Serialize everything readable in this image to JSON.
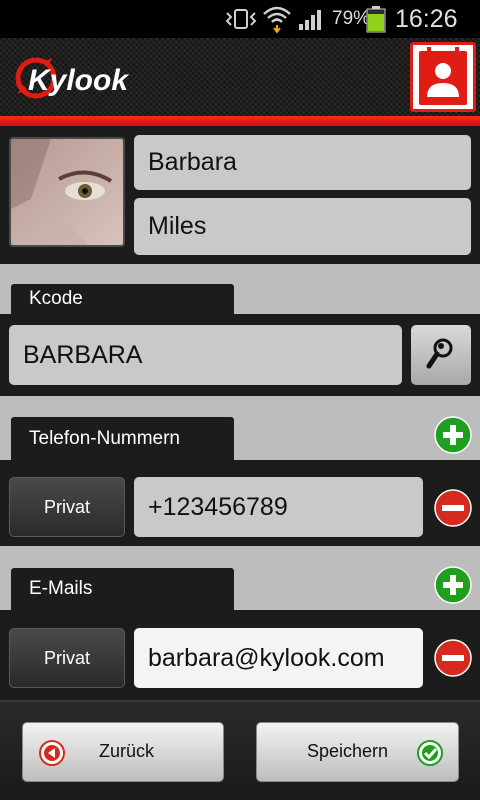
{
  "status_bar": {
    "battery_percent": "79%",
    "time": "16:26",
    "icons": [
      "vibrate-icon",
      "wifi-icon",
      "signal-icon",
      "battery-icon"
    ]
  },
  "header": {
    "logo_text": "Kylook",
    "contact_card_icon": "contact-card-icon",
    "accent_color": "#e01c14"
  },
  "contact": {
    "first_name": "Barbara",
    "last_name": "Miles"
  },
  "kcode": {
    "label": "Kcode",
    "value": "BARBARA",
    "search_icon": "magnifier-icon"
  },
  "phones": {
    "label": "Telefon-Nummern",
    "add_icon": "add-icon",
    "items": [
      {
        "type": "Privat",
        "value": "+123456789",
        "remove_icon": "remove-icon"
      }
    ]
  },
  "emails": {
    "label": "E-Mails",
    "add_icon": "add-icon",
    "items": [
      {
        "type": "Privat",
        "value": "barbara@kylook.com",
        "remove_icon": "remove-icon"
      }
    ]
  },
  "footer": {
    "back_label": "Zurück",
    "save_label": "Speichern",
    "back_icon": "back-arrow-icon",
    "save_icon": "check-icon"
  }
}
